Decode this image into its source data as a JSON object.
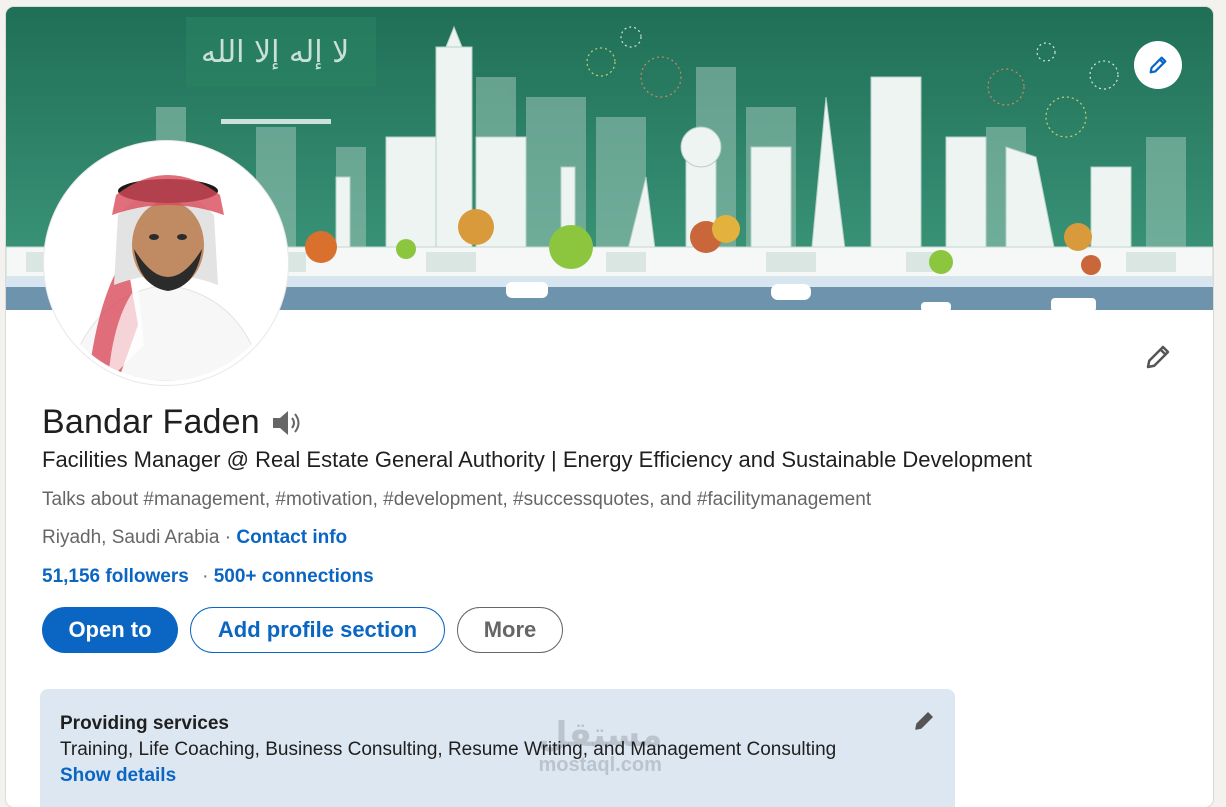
{
  "profile": {
    "name": "Bandar Faden",
    "headline": "Facilities Manager @ Real Estate General Authority | Energy Efficiency and Sustainable Development",
    "talks_about": "Talks about #management, #motivation, #development, #successquotes, and #facilitymanagement",
    "location": "Riyadh, Saudi Arabia",
    "location_separator": " · ",
    "contact_info_label": "Contact info",
    "followers_label": "51,156 followers",
    "stats_separator": " · ",
    "connections_label": "500+ connections"
  },
  "actions": {
    "open_to_label": "Open to",
    "add_section_label": "Add profile section",
    "more_label": "More"
  },
  "services": {
    "title": "Providing services",
    "list": "Training, Life Coaching, Business Consulting, Resume Writing, and Management Consulting",
    "show_details_label": "Show details"
  },
  "watermark": {
    "arabic": "مستقل",
    "latin": "mostaql.com"
  },
  "icons": {
    "banner_edit": "pencil-icon",
    "intro_edit": "pencil-icon",
    "name_pronunciation": "speaker-icon",
    "services_edit": "pencil-icon"
  },
  "colors": {
    "brand_blue": "#0a66c2",
    "banner_green": "#2d7d64",
    "services_bg": "#dde7f1"
  }
}
